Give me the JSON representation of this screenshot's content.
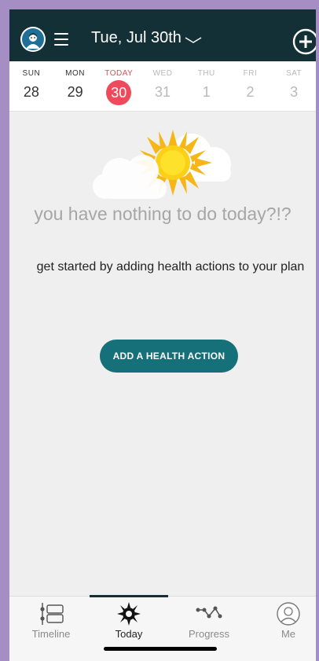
{
  "header": {
    "date_title": "Tue, Jul 30th",
    "avatar_icon": "user-avatar-icon",
    "menu_icon": "hamburger-menu-icon",
    "add_icon": "plus-circle-icon",
    "background": "#143037"
  },
  "week": {
    "days": [
      {
        "name": "SUN",
        "num": "28",
        "state": "past"
      },
      {
        "name": "MON",
        "num": "29",
        "state": "past"
      },
      {
        "name": "TODAY",
        "num": "30",
        "state": "today"
      },
      {
        "name": "WED",
        "num": "31",
        "state": "future"
      },
      {
        "name": "THU",
        "num": "1",
        "state": "future"
      },
      {
        "name": "FRI",
        "num": "2",
        "state": "future"
      },
      {
        "name": "SAT",
        "num": "3",
        "state": "future"
      }
    ],
    "today_color": "#ef4a5c"
  },
  "empty_state": {
    "illustration": "sun-cloud-icon",
    "title": "you have nothing to do today?!?",
    "subtitle": "get started by adding health actions to your plan",
    "cta_label": "ADD A HEALTH ACTION",
    "cta_color": "#16707a"
  },
  "tabs": [
    {
      "label": "Timeline",
      "icon": "timeline-icon",
      "active": false
    },
    {
      "label": "Today",
      "icon": "sun-icon",
      "active": true
    },
    {
      "label": "Progress",
      "icon": "progress-icon",
      "active": false
    },
    {
      "label": "Me",
      "icon": "profile-icon",
      "active": false
    }
  ]
}
